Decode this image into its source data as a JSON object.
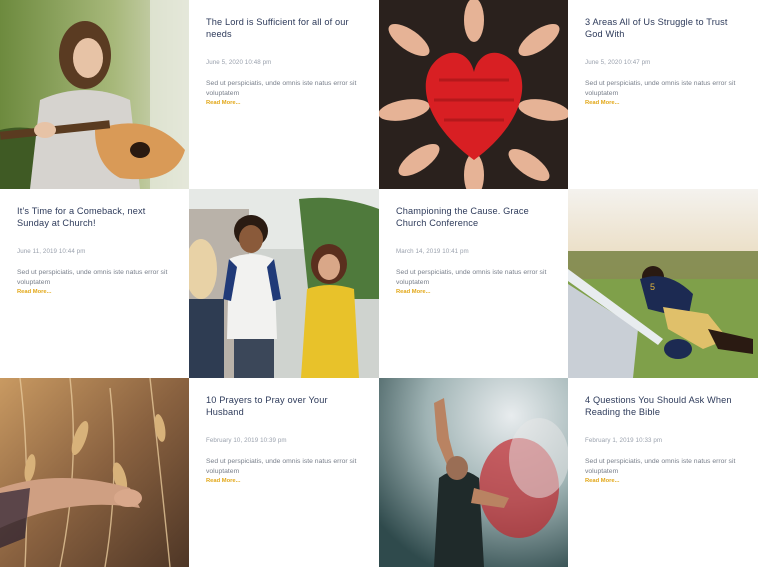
{
  "posts": [
    {
      "title": "The Lord is Sufficient for all of our needs",
      "date": "June 5, 2020 10:48 pm",
      "excerpt": "Sed ut perspiciatis, unde omnis iste natus error sit voluptatem",
      "readmore": "Read More..."
    },
    {
      "title": "3 Areas All of Us Struggle to Trust God With",
      "date": "June 5, 2020 10:47 pm",
      "excerpt": "Sed ut perspiciatis, unde omnis iste natus error sit voluptatem",
      "readmore": "Read More..."
    },
    {
      "title": "It’s Time for a Comeback, next Sunday at Church!",
      "date": "June 11, 2019 10:44 pm",
      "excerpt": "Sed ut perspiciatis, unde omnis iste natus error sit voluptatem",
      "readmore": "Read More..."
    },
    {
      "title": "Championing the Cause. Grace Church Conference",
      "date": "March 14, 2019 10:41 pm",
      "excerpt": "Sed ut perspiciatis, unde omnis iste natus error sit voluptatem",
      "readmore": "Read More..."
    },
    {
      "title": "10 Prayers to Pray over Your Husband",
      "date": "February 10, 2019 10:39 pm",
      "excerpt": "Sed ut perspiciatis, unde omnis iste natus error sit voluptatem",
      "readmore": "Read More..."
    },
    {
      "title": "4 Questions You Should Ask When Reading the Bible",
      "date": "February 1, 2019 10:33 pm",
      "excerpt": "Sed ut perspiciatis, unde omnis iste natus error sit voluptatem",
      "readmore": "Read More..."
    }
  ],
  "colors": {
    "title": "#2d3a5a",
    "date": "#9aa1ad",
    "excerpt": "#7a808c",
    "readmore": "#e2a717"
  }
}
